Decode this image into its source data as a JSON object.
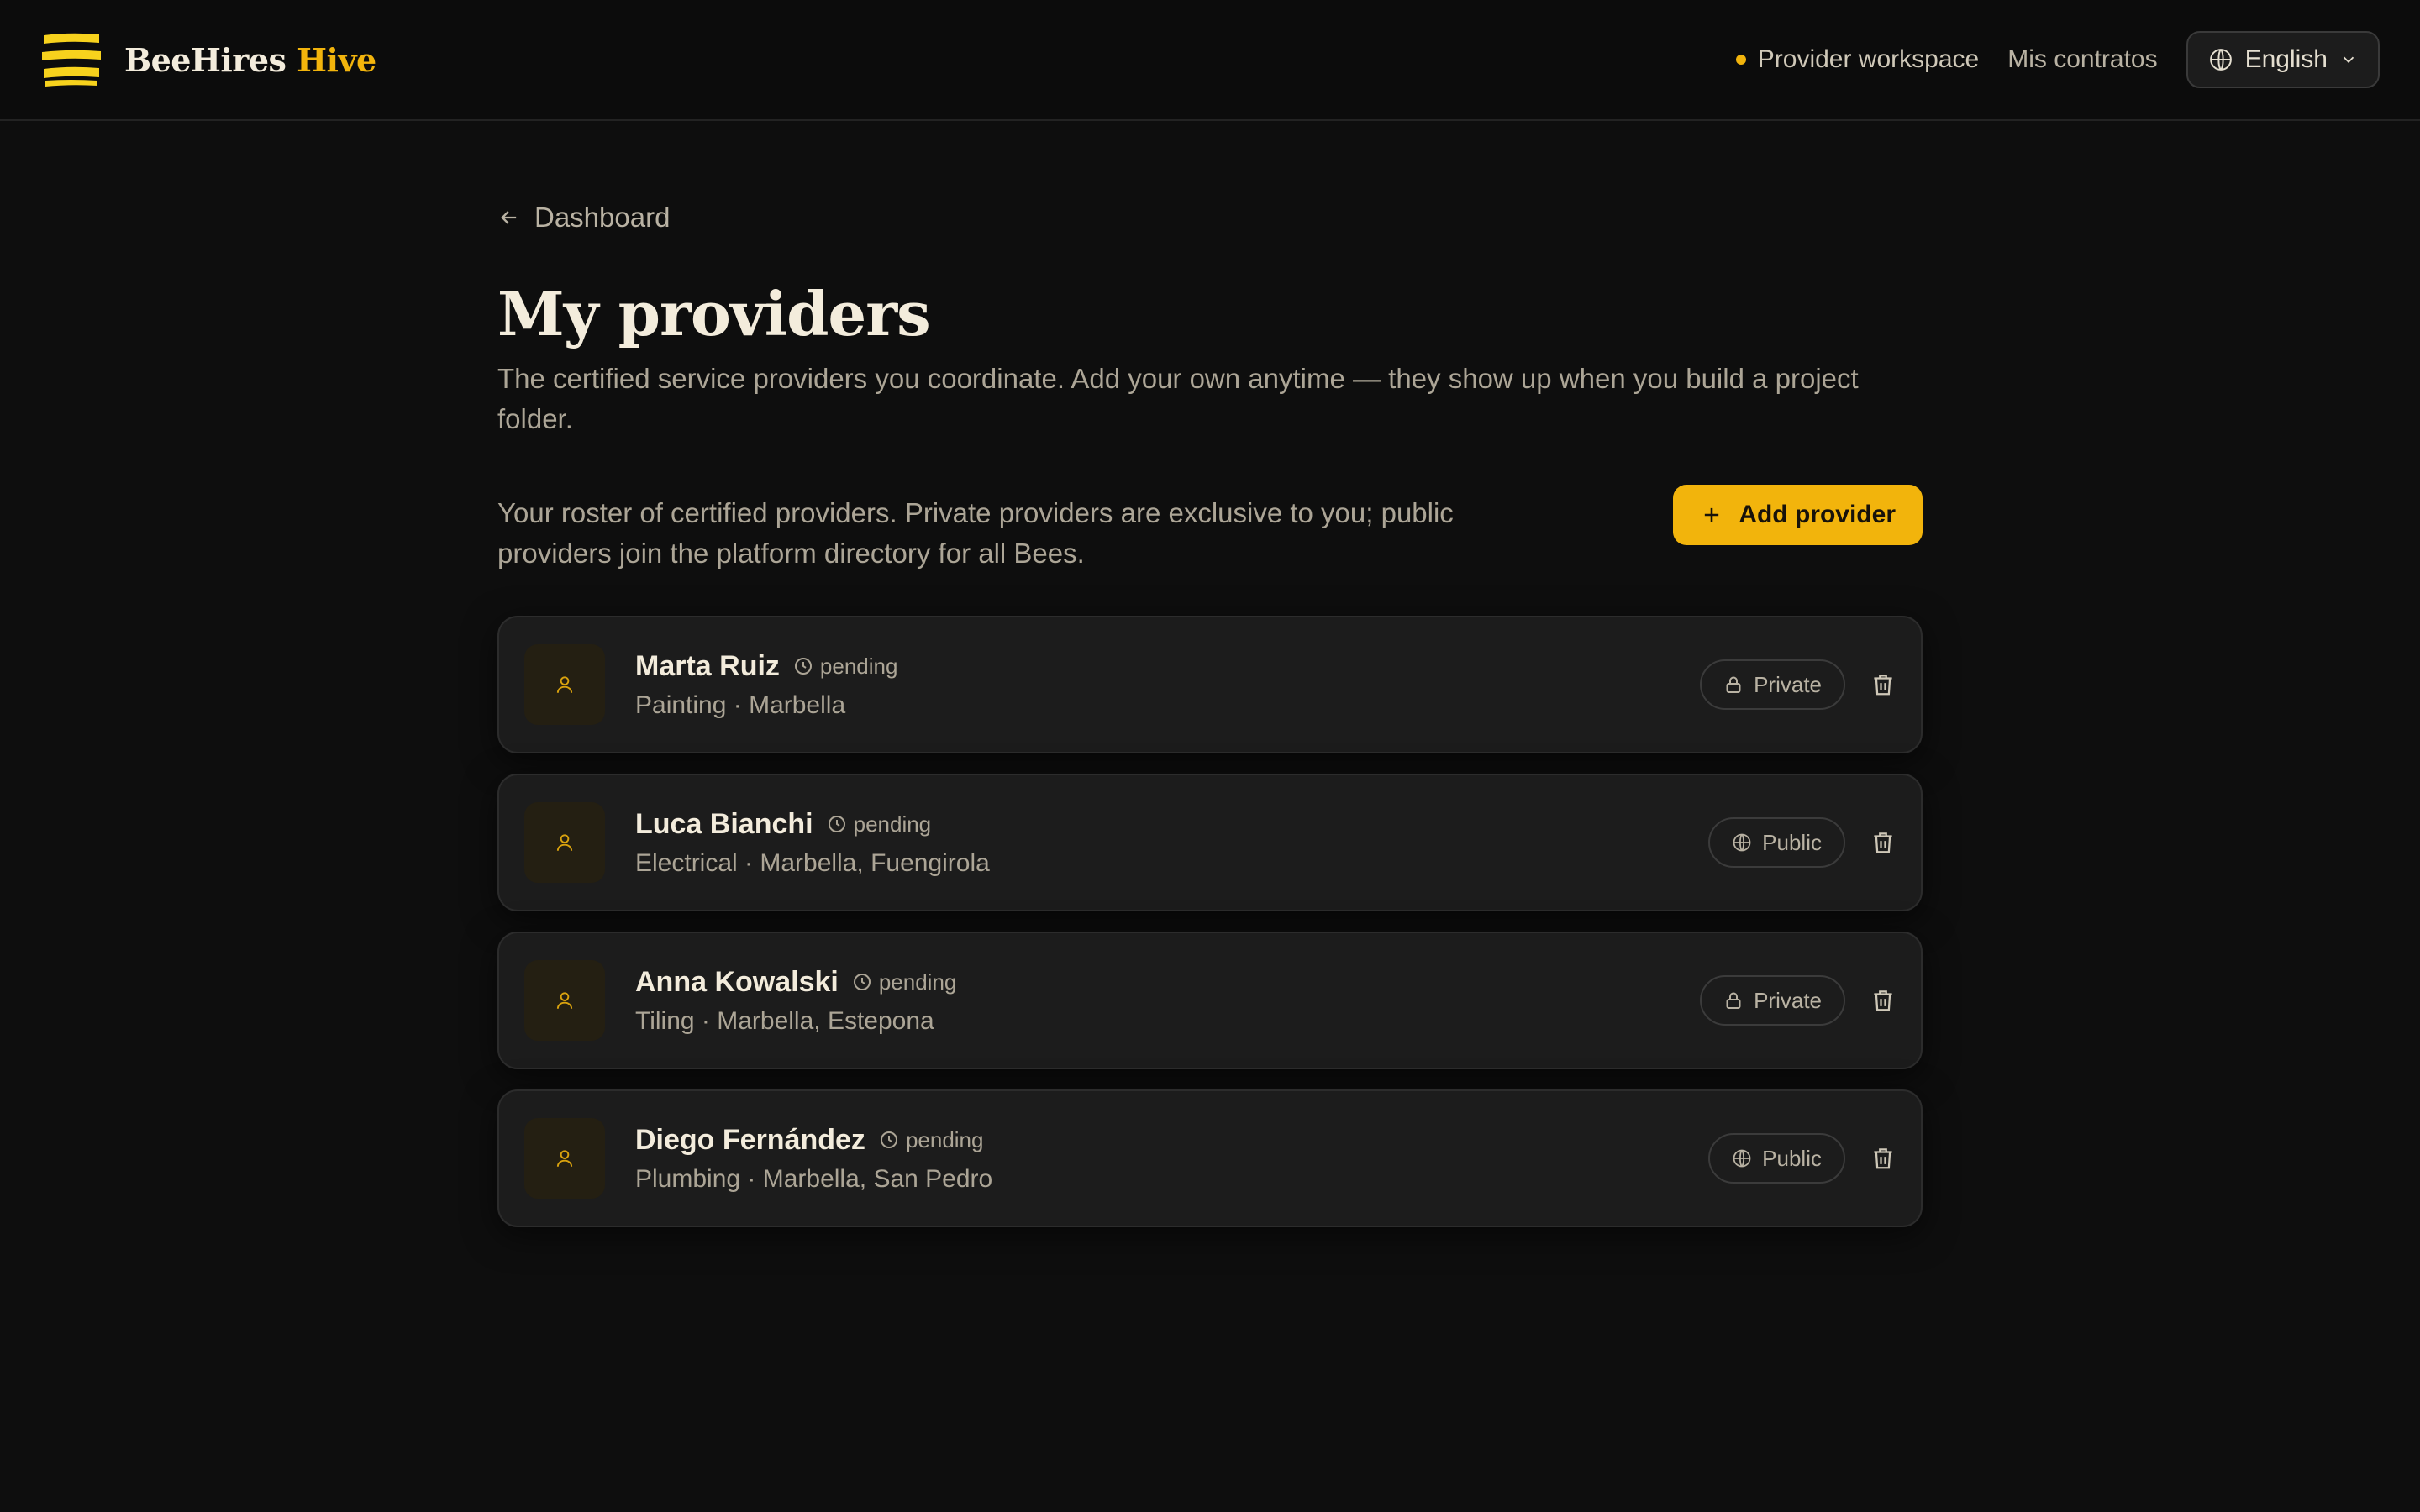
{
  "brand": {
    "name": "BeeHires",
    "accent": "Hive",
    "accent_color": "#f2b40c",
    "logo_icon": "bee-stripes-logo"
  },
  "header": {
    "workspace_label": "Provider workspace",
    "contracts_link": "Mis contratos",
    "language": "English"
  },
  "page": {
    "back_label": "Dashboard",
    "title": "My providers",
    "subtitle": "The certified service providers you coordinate. Add your own anytime — they show up when you build a project folder.",
    "roster_text": "Your roster of certified providers. Private providers are exclusive to you; public providers join the platform directory for all Bees.",
    "add_button": "Add provider"
  },
  "providers": [
    {
      "name": "Marta Ruiz",
      "status": "pending",
      "meta": "Painting · Marbella",
      "visibility": "Private",
      "visibility_icon": "lock-icon"
    },
    {
      "name": "Luca Bianchi",
      "status": "pending",
      "meta": "Electrical · Marbella, Fuengirola",
      "visibility": "Public",
      "visibility_icon": "globe-icon"
    },
    {
      "name": "Anna Kowalski",
      "status": "pending",
      "meta": "Tiling · Marbella, Estepona",
      "visibility": "Private",
      "visibility_icon": "lock-icon"
    },
    {
      "name": "Diego Fernández",
      "status": "pending",
      "meta": "Plumbing · Marbella, San Pedro",
      "visibility": "Public",
      "visibility_icon": "globe-icon"
    }
  ]
}
